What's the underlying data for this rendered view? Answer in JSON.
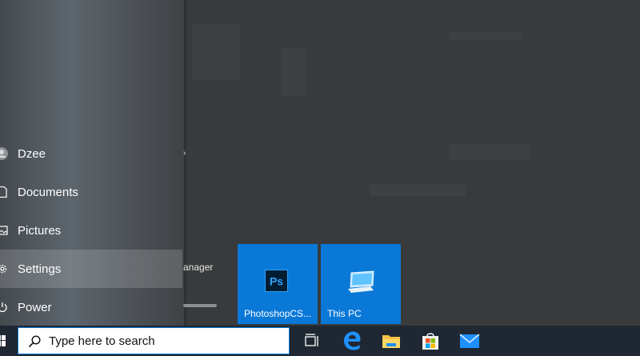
{
  "start_menu": {
    "nav": [
      {
        "label": "Dzee",
        "icon": "user-avatar-icon"
      },
      {
        "label": "Documents",
        "icon": "document-icon"
      },
      {
        "label": "Pictures",
        "icon": "pictures-icon"
      },
      {
        "label": "Settings",
        "icon": "gear-icon"
      },
      {
        "label": "Power",
        "icon": "power-icon"
      }
    ],
    "peek_text": "anager",
    "tiles": [
      {
        "label": "PhotoshopCS...",
        "icon": "photoshop-icon"
      },
      {
        "label": "This PC",
        "icon": "computer-icon"
      }
    ]
  },
  "taskbar": {
    "search_placeholder": "Type here to search",
    "pinned": [
      "task-view-icon",
      "edge-icon",
      "file-explorer-icon",
      "store-icon",
      "mail-icon"
    ]
  },
  "colors": {
    "accent": "#0a78d7",
    "taskbar": "#1f2832"
  }
}
